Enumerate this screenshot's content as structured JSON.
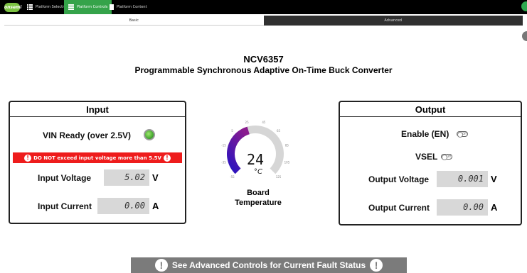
{
  "topbar": {
    "logo": "onsemi",
    "nav": [
      {
        "label": "Platform Selection"
      },
      {
        "label": "Platform Controls"
      },
      {
        "label": "Platform Content"
      }
    ]
  },
  "tabs": [
    {
      "label": "Basic"
    },
    {
      "label": "Advanced"
    }
  ],
  "header": {
    "part": "NCV6357",
    "subtitle": "Programmable Synchronous Adaptive On-Time Buck Converter"
  },
  "input": {
    "title": "Input",
    "vin_ready_label": "VIN Ready (over 2.5V)",
    "vin_ready_color": "#3aa028",
    "warning": "DO NOT exceed input voltage more than 5.5V",
    "warning_color": "#ee1c1c",
    "voltage_label": "Input Voltage",
    "voltage_value": "5.02",
    "voltage_unit": "V",
    "current_label": "Input Current",
    "current_value": "0.00",
    "current_unit": "A"
  },
  "gauge": {
    "value": "24",
    "unit": "°C",
    "min": -55,
    "max": 125,
    "ticks": [
      "-55",
      "-35",
      "-15",
      "5",
      "25",
      "45",
      "65",
      "85",
      "105",
      "125"
    ],
    "label_line1": "Board",
    "label_line2": "Temperature"
  },
  "output": {
    "title": "Output",
    "enable_label": "Enable (EN)",
    "enable_state": "Off",
    "vsel_label": "VSEL",
    "vsel_state": "Off",
    "voltage_label": "Output Voltage",
    "voltage_value": "0.001",
    "voltage_unit": "V",
    "current_label": "Output Current",
    "current_value": "0.00",
    "current_unit": "A"
  },
  "fault": {
    "text": "See Advanced Controls for Current Fault Status"
  }
}
